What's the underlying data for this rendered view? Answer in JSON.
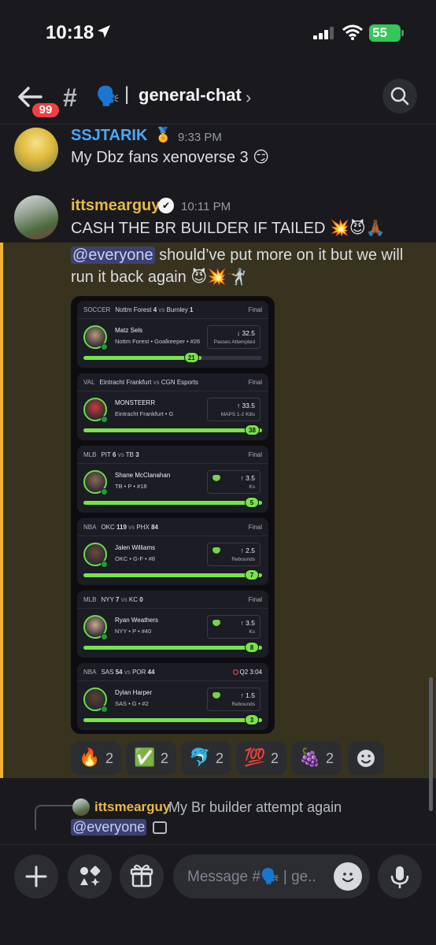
{
  "status_bar": {
    "time": "10:18",
    "battery": "55"
  },
  "header": {
    "unread_count": "99",
    "channel_emoji": "🗣️",
    "separator": "|",
    "channel_name": "general-chat"
  },
  "messages": [
    {
      "author": "SSJTARIK",
      "author_color": "#4aa8ff",
      "badge": "🏅",
      "time": "9:33 PM",
      "text": "My Dbz fans xenoverse 3 😏"
    },
    {
      "author": "ittsmearguy",
      "author_color": "#e6b84a",
      "badge": "✔",
      "time": "10:11 PM",
      "text": "CASH THE BR BUILDER IF TAILED 💥😈🙏🏾",
      "mention": "@everyone",
      "text2": " should’ve put more on it but we will run it back again 😈💥🤺"
    }
  ],
  "bet_cards": [
    {
      "league": "SOCCER",
      "team1": "Nottm Forest",
      "score1": "4",
      "vs": "vs",
      "team2": "Burnley",
      "score2": "1",
      "status": "Final",
      "live": false,
      "player": "Matz Sels",
      "meta": "Nottm Forest • Goalkeeper • #26",
      "direction": "↓",
      "line": "32.5",
      "stat": "Passes Attempted",
      "goblin": false,
      "result": "21",
      "progress": 0.66
    },
    {
      "league": "VAL",
      "team1": "Eintracht Frankfurt",
      "score1": "",
      "vs": "vs",
      "team2": "CGN Esports",
      "score2": "",
      "status": "Final",
      "live": false,
      "player": "MONSTEERR",
      "meta": "Eintracht Frankfurt • G",
      "direction": "↑",
      "line": "33.5",
      "stat": "MAPS 1-2 Kills",
      "goblin": false,
      "result": "38",
      "progress": 1.0
    },
    {
      "league": "MLB",
      "team1": "PIT",
      "score1": "6",
      "vs": "vs",
      "team2": "TB",
      "score2": "3",
      "status": "Final",
      "live": false,
      "player": "Shane McClanahan",
      "meta": "TB • P • #18",
      "direction": "↑",
      "line": "3.5",
      "stat": "Ks",
      "goblin": true,
      "result": "5",
      "progress": 1.0
    },
    {
      "league": "NBA",
      "team1": "OKC",
      "score1": "119",
      "vs": "vs",
      "team2": "PHX",
      "score2": "84",
      "status": "Final",
      "live": false,
      "player": "Jalen Williams",
      "meta": "OKC • G-F • #8",
      "direction": "↑",
      "line": "2.5",
      "stat": "Rebounds",
      "goblin": true,
      "result": "7",
      "progress": 1.0
    },
    {
      "league": "MLB",
      "team1": "NYY",
      "score1": "7",
      "vs": "vs",
      "team2": "KC",
      "score2": "0",
      "status": "Final",
      "live": false,
      "player": "Ryan Weathers",
      "meta": "NYY • P • #40",
      "direction": "↑",
      "line": "3.5",
      "stat": "Ks",
      "goblin": true,
      "result": "8",
      "progress": 1.0
    },
    {
      "league": "NBA",
      "team1": "SAS",
      "score1": "54",
      "vs": "vs",
      "team2": "POR",
      "score2": "44",
      "status": "Q2 3:04",
      "live": true,
      "player": "Dylan Harper",
      "meta": "SAS • G • #2",
      "direction": "↑",
      "line": "1.5",
      "stat": "Rebounds",
      "goblin": true,
      "result": "3",
      "progress": 1.0
    }
  ],
  "reactions": [
    {
      "emoji": "🔥",
      "count": "2"
    },
    {
      "emoji": "✅",
      "count": "2"
    },
    {
      "emoji": "🐬",
      "count": "2"
    },
    {
      "emoji": "💯",
      "count": "2"
    },
    {
      "emoji": "🍇",
      "count": "2"
    }
  ],
  "reply_preview": {
    "author": "ittsmearguy",
    "text": "My Br builder attempt again",
    "mention": "@everyone"
  },
  "composer": {
    "placeholder": "Message #🗣️ | ge.."
  },
  "colors": {
    "accent_mention_bg": "#3c4270",
    "highlight_bg": "#37331f",
    "highlight_bar": "#f0b232",
    "progress_green": "#79e34a"
  }
}
